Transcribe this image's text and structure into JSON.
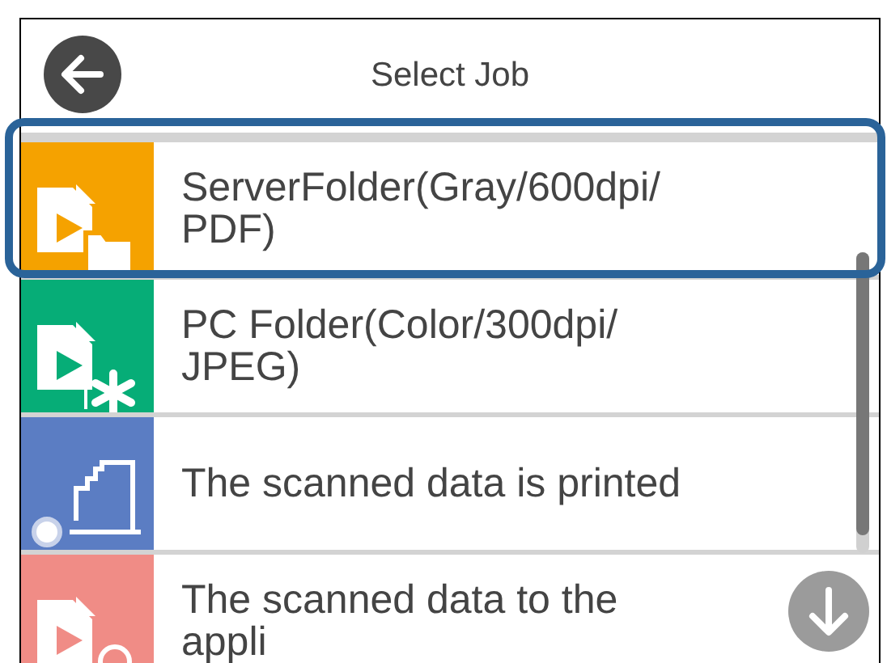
{
  "header": {
    "title": "Select Job"
  },
  "jobs": [
    {
      "kind": "server-folder",
      "color": "#f5a200",
      "selected": true,
      "lines": [
        "ServerFolder(Gray/600dpi/",
        "PDF)"
      ]
    },
    {
      "kind": "pc-folder",
      "color": "#06ad77",
      "selected": false,
      "lines": [
        "PC Folder(Color/300dpi/",
        "JPEG)"
      ]
    },
    {
      "kind": "print",
      "color": "#5b7dc3",
      "selected": false,
      "lines": [
        "The scanned data is printed"
      ]
    },
    {
      "kind": "app",
      "color": "#f08c86",
      "selected": false,
      "lines": [
        "The scanned data to the",
        "appli"
      ]
    }
  ]
}
